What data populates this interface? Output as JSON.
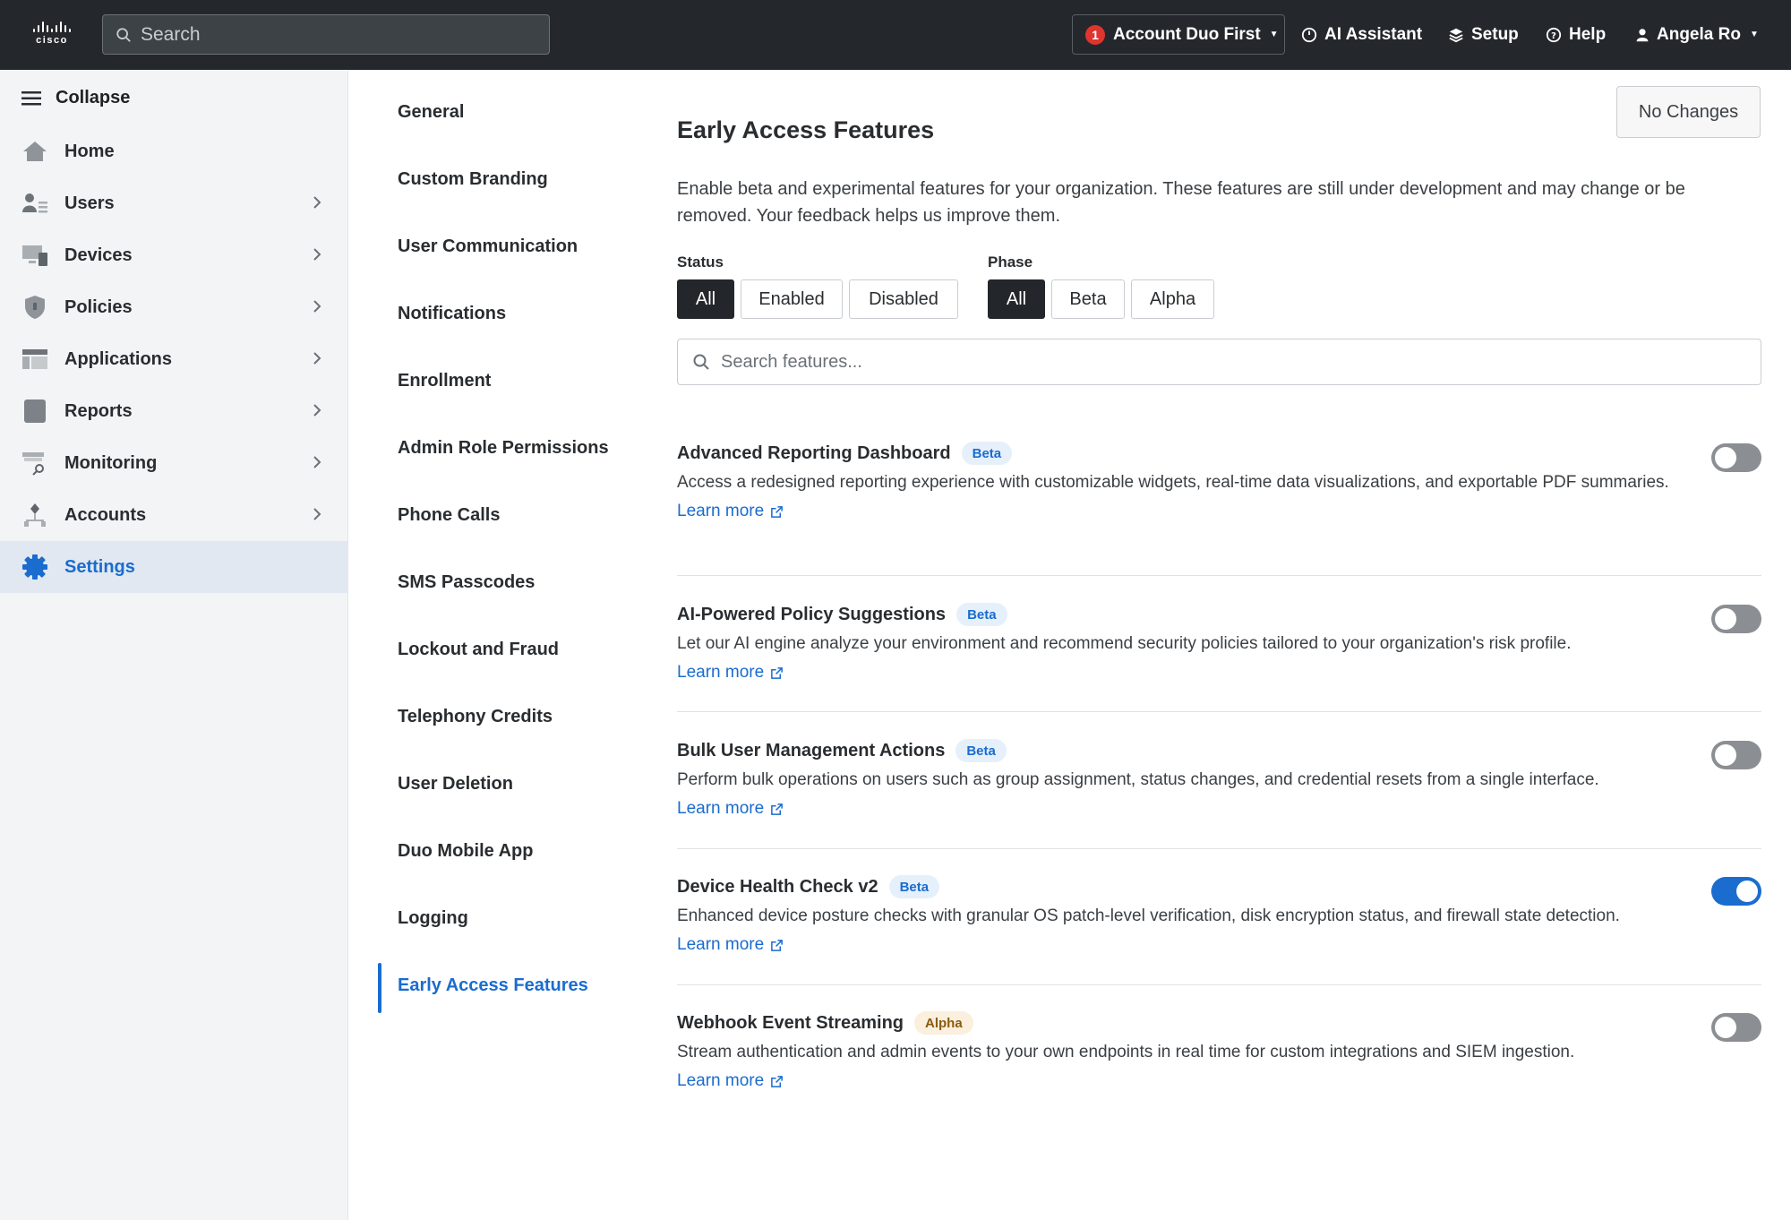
{
  "topbar": {
    "logo_text": "cisco",
    "search_placeholder": "Search",
    "account_badge": "1",
    "account_label": "Account Duo First",
    "ai_assistant": "AI Assistant",
    "setup": "Setup",
    "help": "Help",
    "user": "Angela Ro"
  },
  "sidebar": {
    "collapse": "Collapse",
    "items": [
      {
        "label": "Home",
        "icon": "home-icon"
      },
      {
        "label": "Users",
        "icon": "users-icon"
      },
      {
        "label": "Devices",
        "icon": "devices-icon"
      },
      {
        "label": "Policies",
        "icon": "shield-icon"
      },
      {
        "label": "Applications",
        "icon": "applications-icon"
      },
      {
        "label": "Reports",
        "icon": "reports-icon"
      },
      {
        "label": "Monitoring",
        "icon": "monitoring-icon"
      },
      {
        "label": "Accounts",
        "icon": "accounts-icon"
      },
      {
        "label": "Settings",
        "icon": "gear-icon",
        "active": true
      }
    ]
  },
  "subnav": {
    "items": [
      "General",
      "Custom Branding",
      "User Communication",
      "Notifications",
      "Enrollment",
      "Admin Role Permissions",
      "Phone Calls",
      "SMS Passcodes",
      "Lockout and Fraud",
      "Telephony Credits",
      "User Deletion",
      "Duo Mobile App",
      "Logging",
      "Early Access Features"
    ],
    "active": "Early Access Features"
  },
  "main": {
    "no_changes": "No Changes",
    "title": "Early Access Features",
    "description": "Enable beta and experimental features for your organization. These features are still under development and may change or be removed. Your feedback helps us improve them.",
    "status_label": "Status",
    "status_options": [
      "All",
      "Enabled",
      "Disabled"
    ],
    "status_selected": "All",
    "phase_label": "Phase",
    "phase_options": [
      "All",
      "Beta",
      "Alpha"
    ],
    "phase_selected": "All",
    "search_placeholder": "Search features...",
    "learn_more": "Learn more",
    "features": [
      {
        "name": "Advanced Reporting Dashboard",
        "tag": "Beta",
        "description": "Access a redesigned reporting experience with customizable widgets, real-time data visualizations, and exportable PDF summaries.",
        "enabled": false
      },
      {
        "name": "AI-Powered Policy Suggestions",
        "tag": "Beta",
        "description": "Let our AI engine analyze your environment and recommend security policies tailored to your organization's risk profile.",
        "enabled": false
      },
      {
        "name": "Bulk User Management Actions",
        "tag": "Beta",
        "description": "Perform bulk operations on users such as group assignment, status changes, and credential resets from a single interface.",
        "enabled": false
      },
      {
        "name": "Device Health Check v2",
        "tag": "Beta",
        "description": "Enhanced device posture checks with granular OS patch-level verification, disk encryption status, and firewall state detection.",
        "enabled": true
      },
      {
        "name": "Webhook Event Streaming",
        "tag": "Alpha",
        "description": "Stream authentication and admin events to your own endpoints in real time for custom integrations and SIEM ingestion.",
        "enabled": false
      }
    ]
  },
  "colors": {
    "topbar": "#24282c",
    "accent": "#1a6ccf",
    "sidebar_bg": "#f3f4f5",
    "active_bg": "#e1e8f1"
  }
}
